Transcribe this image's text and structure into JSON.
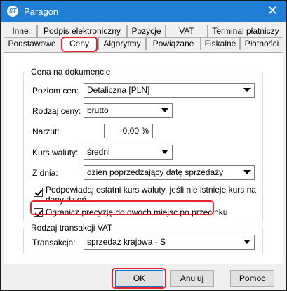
{
  "window": {
    "title": "Paragon",
    "app_icon_text": "ST"
  },
  "tabs_row1": [
    "Inne",
    "Podpis elektroniczny",
    "Pozycje",
    "VAT",
    "Terminal płatniczy"
  ],
  "tabs_row2": [
    "Podstawowe",
    "Ceny",
    "Algorytmy",
    "Powiązane",
    "Fiskalne",
    "Płatności"
  ],
  "active_tab": "Ceny",
  "price_group": {
    "title": "Cena na dokumencie",
    "poziom_cen": {
      "label": "Poziom cen:",
      "value": "Detaliczna [PLN]"
    },
    "rodzaj_ceny": {
      "label": "Rodzaj ceny:",
      "value": "brutto"
    },
    "narzut": {
      "label": "Narzut:",
      "value": "0,00 %"
    },
    "kurs_waluty": {
      "label": "Kurs waluty:",
      "value": "średni"
    },
    "z_dnia": {
      "label": "Z dnia:",
      "value": "dzień poprzedzający datę sprzedaży"
    },
    "checkbox_suggest": {
      "line1": "Podpowiadaj ostatni kurs waluty, jeśli nie istnieje kurs na",
      "line2": "dany dzień",
      "checked": true
    },
    "checkbox_precision": {
      "label": "Ogranicz precyzję do dwóch miejsc po przecinku",
      "checked": true
    }
  },
  "vat_group": {
    "title": "Rodzaj transakcji VAT",
    "transakcja": {
      "label": "Transakcja:",
      "value": "sprzedaż krajowa - S"
    }
  },
  "buttons": {
    "ok": "OK",
    "cancel": "Anuluj",
    "help": "Pomoc"
  },
  "colors": {
    "titlebar": "#1e7fd4",
    "highlight": "#e8232c",
    "focus": "#0078d7"
  }
}
